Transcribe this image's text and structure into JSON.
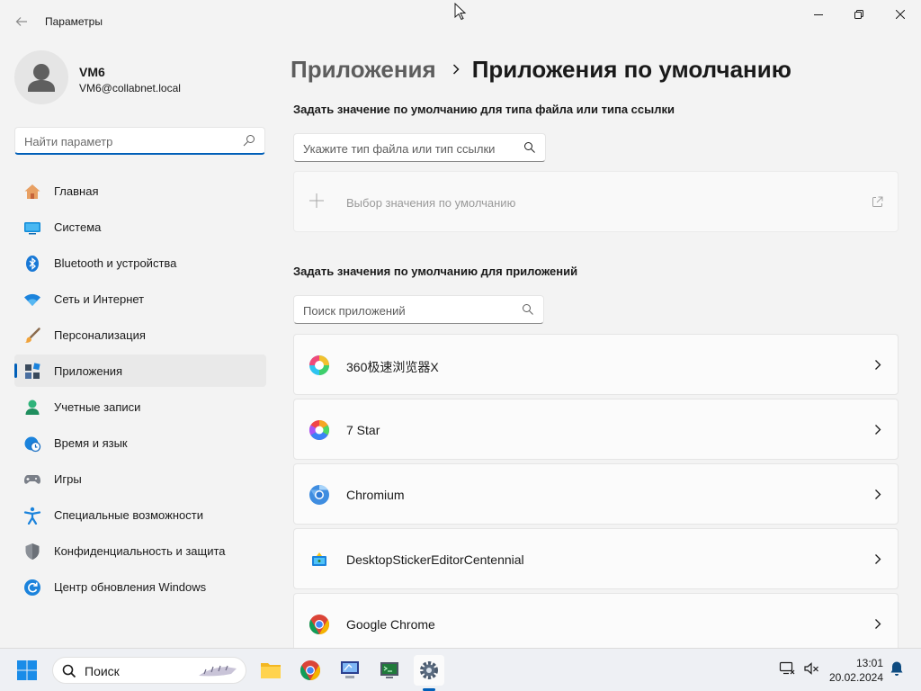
{
  "window": {
    "title": "Параметры",
    "back_icon": "back-arrow-icon",
    "controls": [
      "minimize-icon",
      "restore-icon",
      "close-icon"
    ]
  },
  "profile": {
    "name": "VM6",
    "email": "VM6@collabnet.local"
  },
  "sidebar": {
    "search_placeholder": "Найти параметр",
    "items": [
      {
        "label": "Главная",
        "icon": "home-icon"
      },
      {
        "label": "Система",
        "icon": "system-display-icon"
      },
      {
        "label": "Bluetooth и устройства",
        "icon": "bluetooth-icon"
      },
      {
        "label": "Сеть и Интернет",
        "icon": "wifi-icon"
      },
      {
        "label": "Персонализация",
        "icon": "brush-icon"
      },
      {
        "label": "Приложения",
        "icon": "apps-icon",
        "active": true
      },
      {
        "label": "Учетные записи",
        "icon": "account-icon"
      },
      {
        "label": "Время и язык",
        "icon": "clock-globe-icon"
      },
      {
        "label": "Игры",
        "icon": "gamepad-icon"
      },
      {
        "label": "Специальные возможности",
        "icon": "accessibility-icon"
      },
      {
        "label": "Конфиденциальность и защита",
        "icon": "shield-icon"
      },
      {
        "label": "Центр обновления Windows",
        "icon": "update-icon"
      }
    ]
  },
  "main": {
    "breadcrumb": {
      "parent": "Приложения",
      "current": "Приложения по умолчанию"
    },
    "filetype_section": {
      "title": "Задать значение по умолчанию для типа файла или типа ссылки",
      "placeholder": "Укажите тип файла или тип ссылки",
      "pick_label": "Выбор значения по умолчанию"
    },
    "apps_section": {
      "title": "Задать значения по умолчанию для приложений",
      "placeholder": "Поиск приложений",
      "apps": [
        {
          "name": "360极速浏览器X",
          "icon": "360-browser-icon"
        },
        {
          "name": "7 Star",
          "icon": "7star-browser-icon"
        },
        {
          "name": "Chromium",
          "icon": "chromium-icon"
        },
        {
          "name": "DesktopStickerEditorCentennial",
          "icon": "sticker-editor-icon"
        },
        {
          "name": "Google Chrome",
          "icon": "chrome-icon"
        }
      ]
    }
  },
  "taskbar": {
    "search_label": "Поиск",
    "apps": [
      "file-explorer-icon",
      "chrome-icon",
      "remote-desktop-icon",
      "terminal-icon",
      "settings-gear-icon"
    ],
    "time": "13:01",
    "date": "20.02.2024"
  },
  "colors": {
    "accent": "#005fb8",
    "background": "#f3f3f3",
    "card": "#fbfbfb"
  }
}
